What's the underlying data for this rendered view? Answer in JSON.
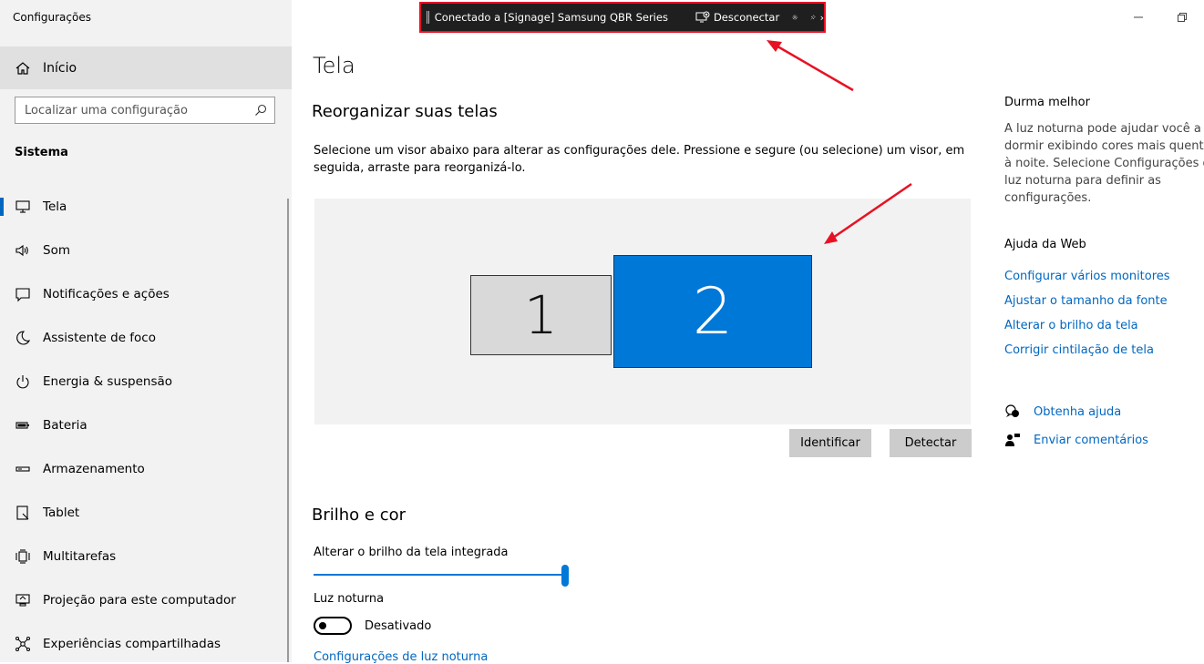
{
  "window": {
    "title": "Configurações"
  },
  "sidebar": {
    "home_label": "Início",
    "search_placeholder": "Localizar uma configuração",
    "section_title": "Sistema",
    "items": [
      {
        "label": "Tela",
        "icon": "monitor-icon",
        "active": true
      },
      {
        "label": "Som",
        "icon": "speaker-icon"
      },
      {
        "label": "Notificações e ações",
        "icon": "notification-icon"
      },
      {
        "label": "Assistente de foco",
        "icon": "moon-icon"
      },
      {
        "label": "Energia & suspensão",
        "icon": "power-icon"
      },
      {
        "label": "Bateria",
        "icon": "battery-icon"
      },
      {
        "label": "Armazenamento",
        "icon": "storage-icon"
      },
      {
        "label": "Tablet",
        "icon": "tablet-icon"
      },
      {
        "label": "Multitarefas",
        "icon": "multitask-icon"
      },
      {
        "label": "Projeção para este computador",
        "icon": "projection-icon"
      },
      {
        "label": "Experiências compartilhadas",
        "icon": "shared-icon"
      }
    ]
  },
  "connection_bar": {
    "status": "Conectado a [Signage] Samsung QBR Series",
    "disconnect_label": "Desconectar"
  },
  "main": {
    "title": "Tela",
    "arrange_heading": "Reorganizar suas telas",
    "arrange_description": "Selecione um visor abaixo para alterar as configurações dele. Pressione e segure (ou selecione) um visor, em seguida, arraste para reorganizá-lo.",
    "monitors": [
      {
        "number": "1",
        "selected": false
      },
      {
        "number": "2",
        "selected": true
      }
    ],
    "identify_label": "Identificar",
    "detect_label": "Detectar",
    "brightness_heading": "Brilho e cor",
    "brightness_label": "Alterar o brilho da tela integrada",
    "brightness_value": 1.0,
    "night_light_label": "Luz noturna",
    "night_light_state": "Desativado",
    "night_light_settings_link": "Configurações de luz noturna"
  },
  "right_panel": {
    "sleep_heading": "Durma melhor",
    "sleep_text": "A luz noturna pode ajudar você a dormir exibindo cores mais quentes à noite. Selecione Configurações de luz noturna para definir as configurações.",
    "web_help_heading": "Ajuda da Web",
    "web_links": [
      "Configurar vários monitores",
      "Ajustar o tamanho da fonte",
      "Alterar o brilho da tela",
      "Corrigir cintilação de tela"
    ],
    "get_help_label": "Obtenha ajuda",
    "feedback_label": "Enviar comentários"
  },
  "colors": {
    "accent": "#0078d7",
    "link": "#0067c0",
    "annotation": "#e81123"
  }
}
